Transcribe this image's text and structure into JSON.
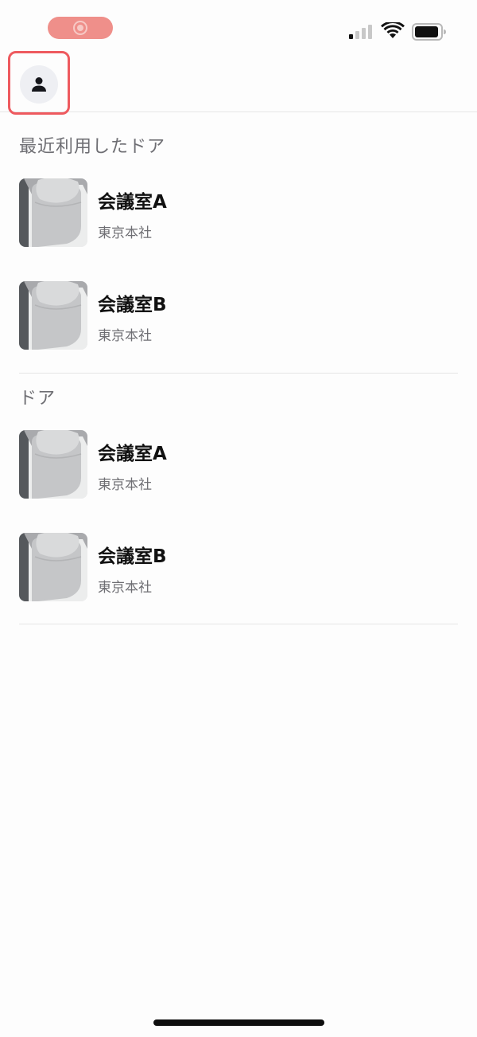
{
  "status_bar": {
    "recording_icon": "screen-recording-icon",
    "signal_icon": "cellular-signal-icon",
    "wifi_icon": "wifi-icon",
    "battery_icon": "battery-icon"
  },
  "header": {
    "profile_icon": "person-icon",
    "highlight_color": "#ee5a5f"
  },
  "sections": {
    "recent": {
      "title": "最近利用したドア",
      "items": [
        {
          "name": "会議室A",
          "location": "東京本社"
        },
        {
          "name": "会議室B",
          "location": "東京本社"
        }
      ]
    },
    "doors": {
      "title": "ドア",
      "items": [
        {
          "name": "会議室A",
          "location": "東京本社"
        },
        {
          "name": "会議室B",
          "location": "東京本社"
        }
      ]
    }
  }
}
